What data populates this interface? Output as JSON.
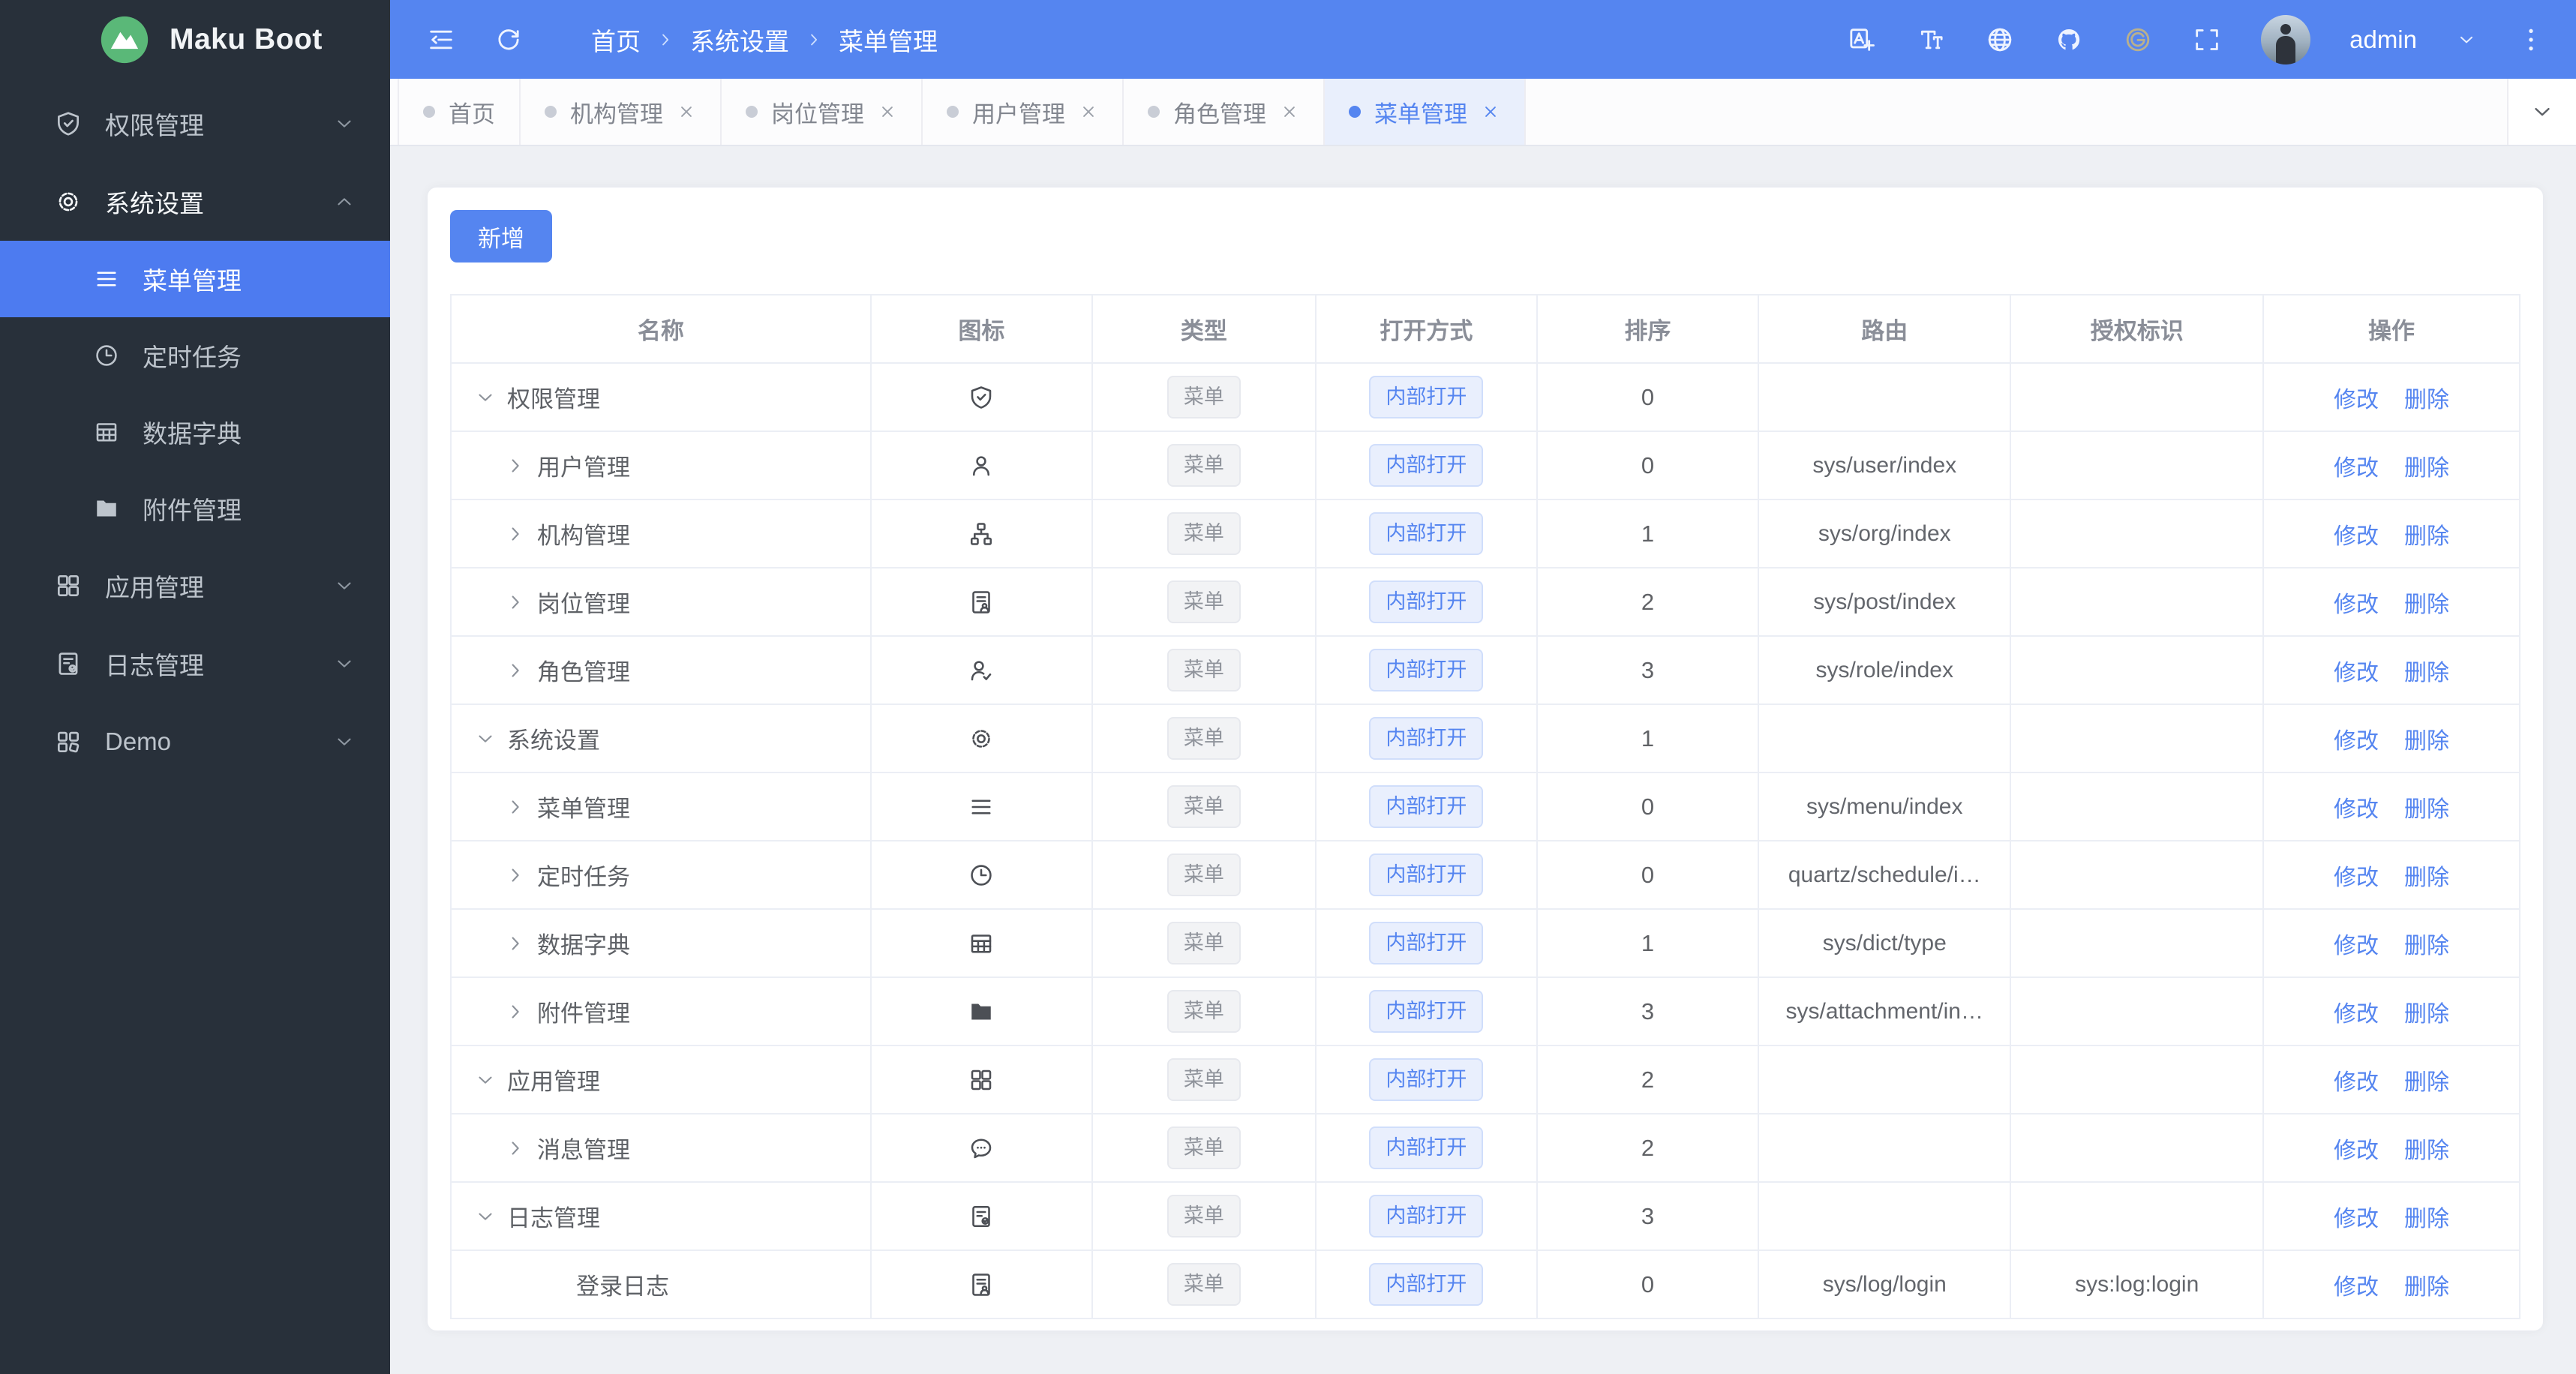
{
  "brand": {
    "logo_text": "Maku Boot",
    "logo_icon": "mountain-logo-icon",
    "logo_color": "#5ab878"
  },
  "header": {
    "breadcrumb": [
      "首页",
      "系统设置",
      "菜单管理"
    ],
    "left_icons": [
      "menu-fold-icon",
      "refresh-icon"
    ],
    "right_icons": [
      "translate-icon",
      "font-size-icon",
      "globe-icon",
      "github-icon",
      "gitee-icon",
      "fullscreen-icon"
    ],
    "username": "admin",
    "accent_color": "#5585f0"
  },
  "tabs": [
    {
      "label": "首页",
      "closable": false,
      "active": false
    },
    {
      "label": "机构管理",
      "closable": true,
      "active": false
    },
    {
      "label": "岗位管理",
      "closable": true,
      "active": false
    },
    {
      "label": "用户管理",
      "closable": true,
      "active": false
    },
    {
      "label": "角色管理",
      "closable": true,
      "active": false
    },
    {
      "label": "菜单管理",
      "closable": true,
      "active": true
    }
  ],
  "sidebar": {
    "items": [
      {
        "label": "权限管理",
        "icon": "shield-check-icon",
        "chevron": "down",
        "open": false,
        "active": false,
        "children": []
      },
      {
        "label": "系统设置",
        "icon": "gear-icon",
        "chevron": "up",
        "open": true,
        "active": false,
        "children": [
          {
            "label": "菜单管理",
            "icon": "menu-lines-icon",
            "active": true
          },
          {
            "label": "定时任务",
            "icon": "clock-icon",
            "active": false
          },
          {
            "label": "数据字典",
            "icon": "dict-icon",
            "active": false
          },
          {
            "label": "附件管理",
            "icon": "folder-icon",
            "active": false
          }
        ]
      },
      {
        "label": "应用管理",
        "icon": "grid-icon",
        "chevron": "down",
        "open": false,
        "active": false,
        "children": []
      },
      {
        "label": "日志管理",
        "icon": "log-icon",
        "chevron": "down",
        "open": false,
        "active": false,
        "children": []
      },
      {
        "label": "Demo",
        "icon": "grid-skew-icon",
        "chevron": "down",
        "open": false,
        "active": false,
        "children": []
      }
    ]
  },
  "toolbar": {
    "add_label": "新增"
  },
  "table": {
    "headers": [
      "名称",
      "图标",
      "类型",
      "打开方式",
      "排序",
      "路由",
      "授权标识",
      "操作"
    ],
    "type_label": "菜单",
    "open_label": "内部打开",
    "edit_label": "修改",
    "delete_label": "删除",
    "rows": [
      {
        "name": "权限管理",
        "level": 0,
        "expand": "down",
        "icon": "shield-check-icon",
        "sort": "0",
        "route": "",
        "perm": ""
      },
      {
        "name": "用户管理",
        "level": 1,
        "expand": "right",
        "icon": "user-icon",
        "sort": "0",
        "route": "sys/user/index",
        "perm": ""
      },
      {
        "name": "机构管理",
        "level": 1,
        "expand": "right",
        "icon": "org-icon",
        "sort": "1",
        "route": "sys/org/index",
        "perm": ""
      },
      {
        "name": "岗位管理",
        "level": 1,
        "expand": "right",
        "icon": "doc-user-icon",
        "sort": "2",
        "route": "sys/post/index",
        "perm": ""
      },
      {
        "name": "角色管理",
        "level": 1,
        "expand": "right",
        "icon": "user-check-icon",
        "sort": "3",
        "route": "sys/role/index",
        "perm": ""
      },
      {
        "name": "系统设置",
        "level": 0,
        "expand": "down",
        "icon": "gear-icon",
        "sort": "1",
        "route": "",
        "perm": ""
      },
      {
        "name": "菜单管理",
        "level": 1,
        "expand": "right",
        "icon": "menu-lines-icon",
        "sort": "0",
        "route": "sys/menu/index",
        "perm": ""
      },
      {
        "name": "定时任务",
        "level": 1,
        "expand": "right",
        "icon": "clock-icon",
        "sort": "0",
        "route": "quartz/schedule/i…",
        "perm": ""
      },
      {
        "name": "数据字典",
        "level": 1,
        "expand": "right",
        "icon": "dict-icon",
        "sort": "1",
        "route": "sys/dict/type",
        "perm": ""
      },
      {
        "name": "附件管理",
        "level": 1,
        "expand": "right",
        "icon": "folder-icon",
        "sort": "3",
        "route": "sys/attachment/in…",
        "perm": ""
      },
      {
        "name": "应用管理",
        "level": 0,
        "expand": "down",
        "icon": "grid-icon",
        "sort": "2",
        "route": "",
        "perm": ""
      },
      {
        "name": "消息管理",
        "level": 1,
        "expand": "right",
        "icon": "chat-icon",
        "sort": "2",
        "route": "",
        "perm": ""
      },
      {
        "name": "日志管理",
        "level": 0,
        "expand": "down",
        "icon": "log-icon",
        "sort": "3",
        "route": "",
        "perm": ""
      },
      {
        "name": "登录日志",
        "level": 2,
        "expand": "none",
        "icon": "doc-user-icon",
        "sort": "0",
        "route": "sys/log/login",
        "perm": "sys:log:login"
      }
    ]
  }
}
